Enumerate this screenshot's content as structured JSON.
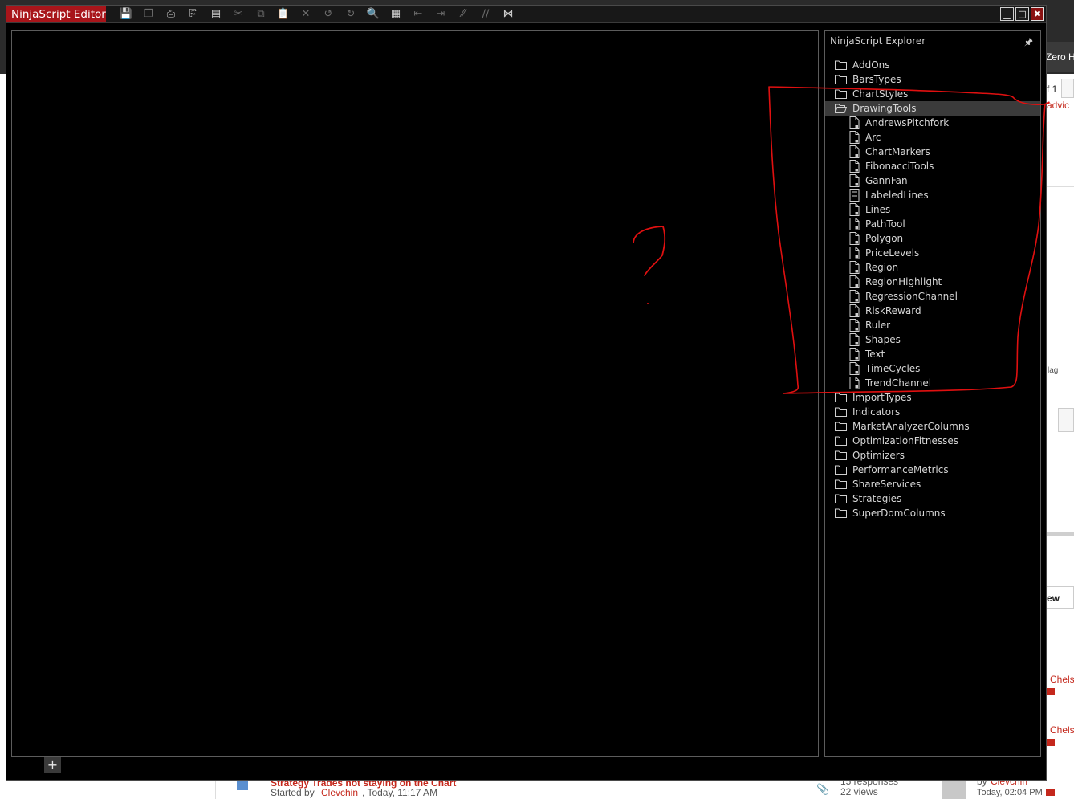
{
  "window": {
    "title": "NinjaScript Editor",
    "add_tab_label": "+"
  },
  "toolbar": {
    "icons": [
      "save-icon",
      "save-all-icon",
      "print-icon",
      "print-preview-icon",
      "page-setup-icon",
      "cut-icon",
      "copy-icon",
      "paste-icon",
      "delete-icon",
      "undo-icon",
      "redo-icon",
      "find-icon",
      "compile-icon",
      "outdent-icon",
      "indent-icon",
      "comment-icon",
      "uncomment-icon",
      "visual-studio-icon"
    ]
  },
  "explorer": {
    "title": "NinjaScript Explorer",
    "folders_before": [
      "AddOns",
      "BarsTypes",
      "ChartStyles"
    ],
    "open_folder": "DrawingTools",
    "files": [
      "AndrewsPitchfork",
      "Arc",
      "ChartMarkers",
      "FibonacciTools",
      "GannFan",
      "LabeledLines",
      "Lines",
      "PathTool",
      "Polygon",
      "PriceLevels",
      "Region",
      "RegionHighlight",
      "RegressionChannel",
      "RiskReward",
      "Ruler",
      "Shapes",
      "Text",
      "TimeCycles",
      "TrendChannel"
    ],
    "folders_after": [
      "ImportTypes",
      "Indicators",
      "MarketAnalyzerColumns",
      "OptimizationFitnesses",
      "Optimizers",
      "PerformanceMetrics",
      "ShareServices",
      "Strategies",
      "SuperDomColumns"
    ]
  },
  "background_page": {
    "topbar_text": "Zero He",
    "pager_text": "f 1",
    "link_fragment": "advic",
    "flag_text": "lag",
    "view_button": "ew",
    "user_fragment_1": "Chels",
    "user_fragment_2": "Chels",
    "thread_title": "Strategy Trades not staying on the Chart",
    "thread_started_prefix": "Started by ",
    "thread_author": "Clevchin",
    "thread_time": ", Today, 11:17 AM",
    "thread_responses": "15 responses",
    "thread_views": "22 views",
    "last_post_prefix": "by ",
    "last_post_author": "Clevchin",
    "last_post_time": "Today, 02:04 PM"
  },
  "annotation": {
    "color": "#e01010",
    "glyph": "question-mark"
  }
}
